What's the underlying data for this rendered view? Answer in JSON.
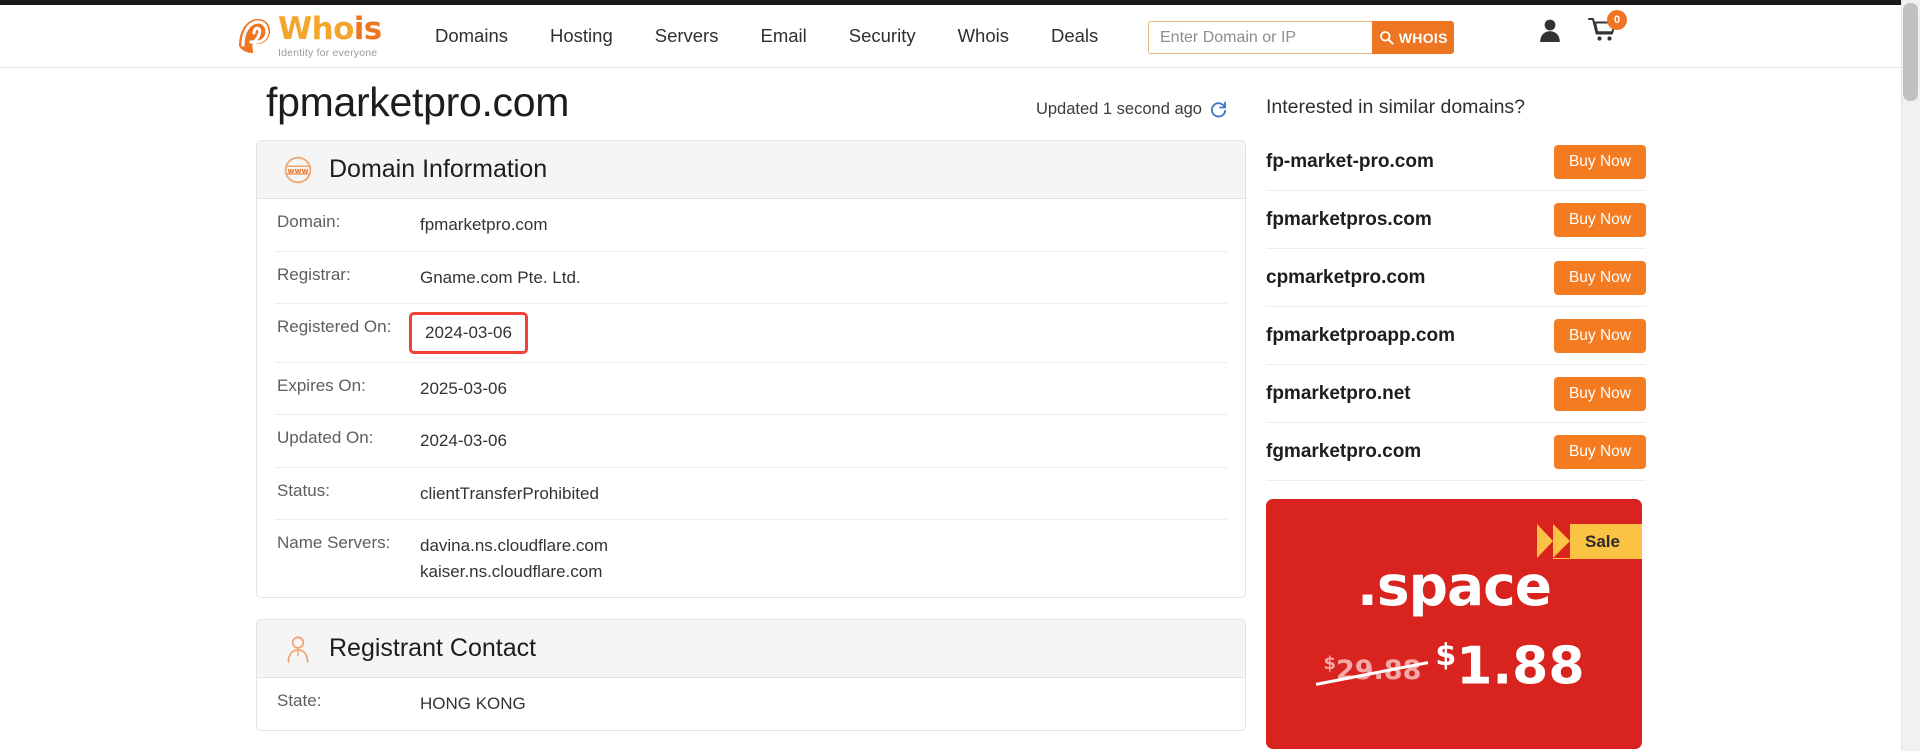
{
  "header": {
    "logo": {
      "word_a": "Who",
      "word_b": "is",
      "tagline": "Identity for everyone",
      "icon": "whois-swoosh-icon"
    },
    "nav": [
      {
        "label": "Domains"
      },
      {
        "label": "Hosting"
      },
      {
        "label": "Servers"
      },
      {
        "label": "Email"
      },
      {
        "label": "Security"
      },
      {
        "label": "Whois"
      },
      {
        "label": "Deals"
      }
    ],
    "search": {
      "value": "",
      "placeholder": "Enter Domain or IP",
      "button_label": "WHOIS",
      "button_icon": "search-icon"
    },
    "account_icon": "user-icon",
    "cart_icon": "cart-icon",
    "cart_count": "0"
  },
  "main": {
    "page_title": "fpmarketpro.com",
    "updated_text": "Updated 1 second ago",
    "refresh_icon": "refresh-icon",
    "domain_information": {
      "icon": "www-globe-icon",
      "title": "Domain Information",
      "rows": [
        {
          "key": "Domain:",
          "value": "fpmarketpro.com"
        },
        {
          "key": "Registrar:",
          "value": "Gname.com Pte. Ltd."
        },
        {
          "key": "Registered On:",
          "value": "2024-03-06",
          "highlighted": true
        },
        {
          "key": "Expires On:",
          "value": "2025-03-06"
        },
        {
          "key": "Updated On:",
          "value": "2024-03-06"
        },
        {
          "key": "Status:",
          "value": "clientTransferProhibited"
        },
        {
          "key": "Name Servers:",
          "value": "davina.ns.cloudflare.com\nkaiser.ns.cloudflare.com"
        }
      ]
    },
    "registrant_contact": {
      "icon": "person-contact-icon",
      "title": "Registrant Contact",
      "rows": [
        {
          "key": "State:",
          "value": "HONG KONG"
        }
      ]
    }
  },
  "sidebar": {
    "heading": "Interested in similar domains?",
    "buy_label": "Buy Now",
    "domains": [
      {
        "name": "fp-market-pro.com"
      },
      {
        "name": "fpmarketpros.com"
      },
      {
        "name": "cpmarketpro.com"
      },
      {
        "name": "fpmarketproapp.com"
      },
      {
        "name": "fpmarketpro.net"
      },
      {
        "name": "fgmarketpro.com"
      }
    ],
    "promo": {
      "ribbon": "Sale",
      "tld": ".space",
      "old_currency": "$",
      "old_price": "29.88",
      "new_currency": "$",
      "new_price": "1.88"
    }
  },
  "colors": {
    "brand_orange": "#ee7522",
    "logo_yellow": "#f2a72c",
    "buy_orange": "#f47b20",
    "promo_red": "#d8231f",
    "ribbon_yellow": "#fbc343",
    "highlight_red": "#ef4136",
    "refresh_blue": "#3b76c4"
  }
}
